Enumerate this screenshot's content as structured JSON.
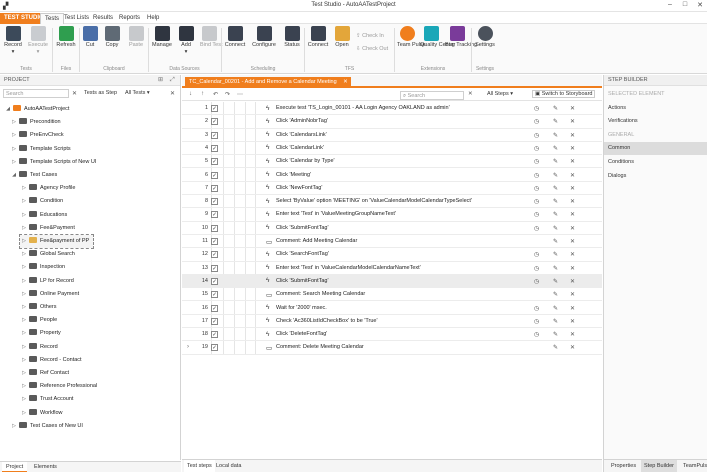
{
  "window": {
    "title": "Test Studio - AutoAATestProject"
  },
  "ribbon_tabs": [
    "TEST STUDIO",
    "Tests",
    "Test Lists",
    "Results",
    "Reports",
    "Help"
  ],
  "ribbon": {
    "record": "Record",
    "execute": "Execute",
    "refresh": "Refresh",
    "cut": "Cut",
    "copy": "Copy",
    "paste": "Paste",
    "manage": "Manage",
    "add": "Add",
    "bind_test": "Bind Test",
    "connect": "Connect",
    "configure": "Configure",
    "status": "Status",
    "connect2": "Connect",
    "open": "Open",
    "check_in": "Check In",
    "check_out": "Check Out",
    "team_pulse": "Team Pulse",
    "quality_center": "Quality Center",
    "bug_tracking": "Bug Tracking",
    "settings": "Settings",
    "groups": {
      "tests": "Tests",
      "files": "Files",
      "clipboard": "Clipboard",
      "data_sources": "Data Sources",
      "scheduling": "Scheduling",
      "tfs": "TFS",
      "extensions": "Extensions",
      "settings": "Settings"
    }
  },
  "project": {
    "header": "PROJECT",
    "search_placeholder": "Search",
    "tests_as_step": "Tests as Step",
    "all_tests": "All Tests",
    "root": "AutoAATestProject",
    "items": [
      "Precondition",
      "PreEnvCheck",
      "Template Scripts",
      "Template Scripts of New UI",
      "Test Cases",
      "Agency Profile",
      "Condition",
      "Educations",
      "Fee&Payment",
      "Fee&payment of PP",
      "Global Search",
      "Inspection",
      "LP for Record",
      "Online Payment",
      "Others",
      "People",
      "Property",
      "Record",
      "Record - Contact",
      "Ref Contact",
      "Reference Professional",
      "Trust Account",
      "Workflow",
      "Test Cases of New UI"
    ],
    "bottom_tabs": [
      "Project",
      "Elements"
    ]
  },
  "editor": {
    "tab_title": "TC_Calendar_00201 - Add and Remove a Calendar Meeting",
    "search_placeholder": "Search",
    "filter": "All Steps",
    "switch_storyboard": "Switch to Storyboard",
    "steps": [
      {
        "n": "1",
        "kind": "action",
        "text": "Execute test 'TS_Login_00101 - AA Login Agency OAKLAND as admin'"
      },
      {
        "n": "2",
        "kind": "action",
        "text": "Click 'AdminNobrTag'"
      },
      {
        "n": "3",
        "kind": "action",
        "text": "Click 'CalendarsLink'"
      },
      {
        "n": "4",
        "kind": "action",
        "text": "Click 'CalendarLink'"
      },
      {
        "n": "5",
        "kind": "action",
        "text": "Click 'Calendar by Type'"
      },
      {
        "n": "6",
        "kind": "action",
        "text": "Click 'Meeting'"
      },
      {
        "n": "7",
        "kind": "action",
        "text": "Click 'NewFontTag'"
      },
      {
        "n": "8",
        "kind": "action",
        "text": "Select 'ByValue' option 'MEETING' on 'ValueCalendarModelCalendarTypeSelect'"
      },
      {
        "n": "9",
        "kind": "action",
        "text": "Enter text 'Test' in 'ValueMeetingGroupNameText'"
      },
      {
        "n": "10",
        "kind": "action",
        "text": "Click 'SubmitFontTag'"
      },
      {
        "n": "11",
        "kind": "comment",
        "text": "Comment: Add Meeting Calendar"
      },
      {
        "n": "12",
        "kind": "action",
        "text": "Click 'SearchFontTag'"
      },
      {
        "n": "13",
        "kind": "action",
        "text": "Enter text 'Test' in 'ValueCalendarModelCalendarNameText'"
      },
      {
        "n": "14",
        "kind": "action",
        "text": "Click 'SubmitFontTag'"
      },
      {
        "n": "15",
        "kind": "comment",
        "text": "Comment: Search Meeting Calendar"
      },
      {
        "n": "16",
        "kind": "action",
        "text": "Wait for '2000' msec."
      },
      {
        "n": "17",
        "kind": "action",
        "text": "Check 'Ac360ListIdCheckBox' to be 'True'"
      },
      {
        "n": "18",
        "kind": "action",
        "text": "Click 'DeleteFontTag'"
      },
      {
        "n": "19",
        "kind": "comment",
        "text": "Comment: Delete Meeting Calendar"
      }
    ],
    "bottom_tabs": [
      "Test steps",
      "Local data"
    ]
  },
  "step_builder": {
    "header": "STEP BUILDER",
    "items": [
      {
        "label": "SELECTED ELEMENT",
        "head": true
      },
      {
        "label": "Actions"
      },
      {
        "label": "Verifications"
      },
      {
        "label": "GENERAL",
        "head": true
      },
      {
        "label": "Common",
        "active": true
      },
      {
        "label": "Conditions"
      },
      {
        "label": "Dialogs"
      }
    ],
    "bottom_tabs": [
      "Properties",
      "Step Builder",
      "TeamPulse"
    ]
  },
  "colors": {
    "accent": "#f07e1d"
  }
}
